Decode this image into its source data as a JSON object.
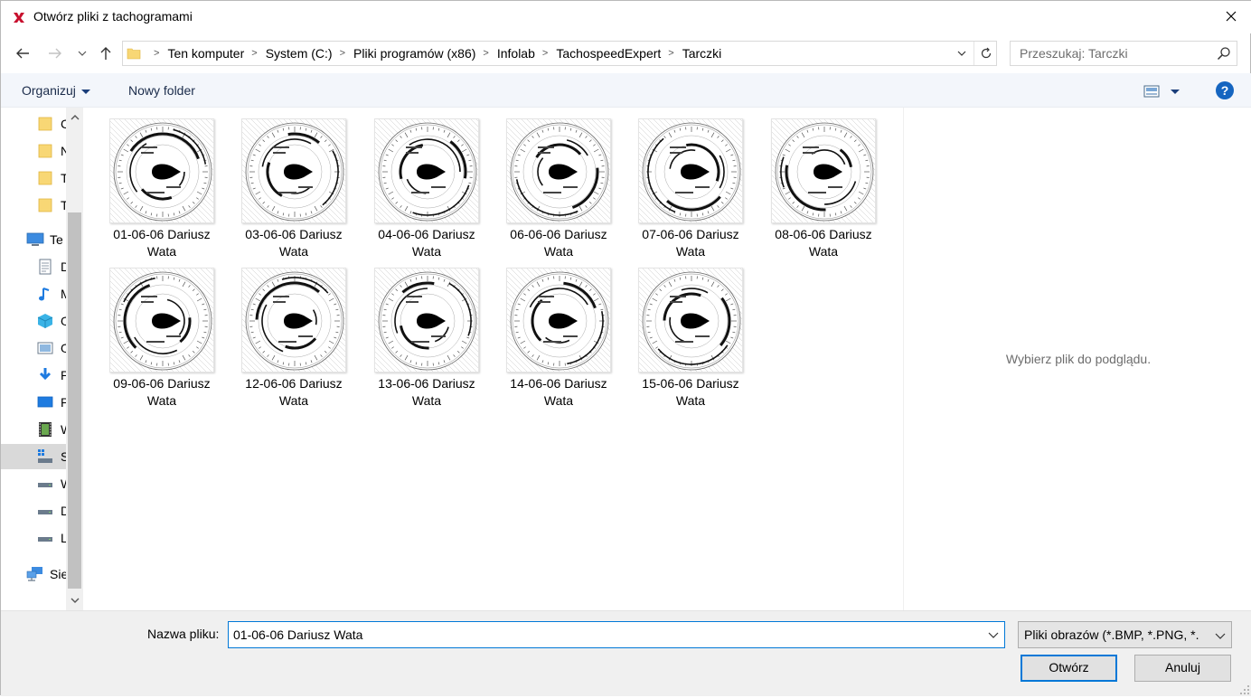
{
  "window": {
    "title": "Otwórz pliki z tachogramami",
    "app_icon_glyph": "✕"
  },
  "address": {
    "crumbs": [
      "Ten komputer",
      "System (C:)",
      "Pliki programów (x86)",
      "Infolab",
      "TachospeedExpert",
      "Tarczki"
    ]
  },
  "search": {
    "placeholder": "Przeszukaj: Tarczki"
  },
  "toolbar": {
    "organize_label": "Organizuj",
    "new_folder_label": "Nowy folder",
    "help_glyph": "?"
  },
  "navpane": {
    "items": [
      {
        "label": "C",
        "icon": "folder-icon"
      },
      {
        "label": "N",
        "icon": "folder-icon"
      },
      {
        "label": "T",
        "icon": "folder-icon"
      },
      {
        "label": "T",
        "icon": "folder-icon"
      },
      {
        "label": "Te",
        "icon": "computer-icon"
      },
      {
        "label": "D",
        "icon": "documents-icon"
      },
      {
        "label": "M",
        "icon": "music-icon"
      },
      {
        "label": "O",
        "icon": "3d-objects-icon"
      },
      {
        "label": "O",
        "icon": "pictures-icon"
      },
      {
        "label": "P",
        "icon": "downloads-icon"
      },
      {
        "label": "P",
        "icon": "desktop-icon"
      },
      {
        "label": "W",
        "icon": "videos-icon"
      },
      {
        "label": "S",
        "icon": "system-drive-icon"
      },
      {
        "label": "W",
        "icon": "drive-icon"
      },
      {
        "label": "D",
        "icon": "drive-icon"
      },
      {
        "label": "L",
        "icon": "drive-icon"
      },
      {
        "label": "Sie",
        "icon": "network-icon"
      }
    ]
  },
  "files": [
    {
      "name": "01-06-06 Dariusz Wata"
    },
    {
      "name": "03-06-06 Dariusz Wata"
    },
    {
      "name": "04-06-06 Dariusz Wata"
    },
    {
      "name": "06-06-06 Dariusz Wata"
    },
    {
      "name": "07-06-06 Dariusz Wata"
    },
    {
      "name": "08-06-06 Dariusz Wata"
    },
    {
      "name": "09-06-06 Dariusz Wata"
    },
    {
      "name": "12-06-06 Dariusz Wata"
    },
    {
      "name": "13-06-06 Dariusz Wata"
    },
    {
      "name": "14-06-06 Dariusz Wata"
    },
    {
      "name": "15-06-06 Dariusz Wata"
    }
  ],
  "preview": {
    "text": "Wybierz plik do podglądu."
  },
  "bottom": {
    "filename_label": "Nazwa pliku:",
    "filename_value": "01-06-06 Dariusz Wata",
    "filetype_value": "Pliki obrazów (*.BMP, *.PNG, *.",
    "open_label": "Otwórz",
    "cancel_label": "Anuluj"
  },
  "colors": {
    "accent": "#0078d7",
    "toolbar_bg": "#f3f6fb",
    "bottom_bg": "#f0f0f0",
    "folder_yellow": "#f8d775",
    "help_blue": "#1565c0"
  }
}
